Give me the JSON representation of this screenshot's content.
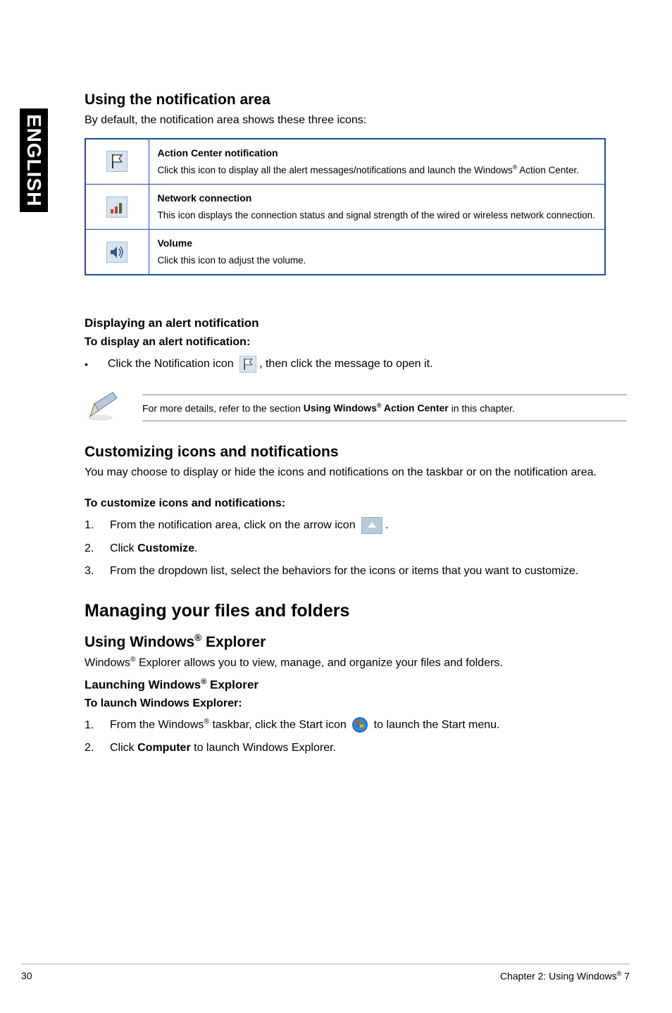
{
  "sidebar": {
    "label": "ENGLISH"
  },
  "section1": {
    "heading": "Using the notification area",
    "intro": "By default, the notification area shows these three icons:",
    "rows": [
      {
        "title": "Action Center notification",
        "desc_pre": "Click this icon to display all the alert messages/notifications and launch the Windows",
        "desc_post": " Action Center."
      },
      {
        "title": "Network connection",
        "desc": "This icon displays the connection status and signal strength of the wired or wireless network connection."
      },
      {
        "title": "Volume",
        "desc": "Click this icon to adjust the volume."
      }
    ]
  },
  "section2": {
    "sub": "Displaying an alert notification",
    "bold": "To display an alert notification:",
    "bullet_pre": "Click the Notification icon ",
    "bullet_post": ", then click the message to open it.",
    "note_pre": "For more details, refer to the section ",
    "note_bold_pre": "Using Windows",
    "note_bold_post": " Action Center",
    "note_post": " in this chapter."
  },
  "section3": {
    "heading": "Customizing icons and notifications",
    "intro": "You may choose to display or hide the icons and notifications on the taskbar or on the notification area.",
    "bold": "To customize icons and notifications:",
    "step1_pre": "From the notification area, click on the arrow icon ",
    "step1_post": ".",
    "step2_pre": "Click ",
    "step2_bold": "Customize",
    "step2_post": ".",
    "step3": "From the dropdown list, select the behaviors for the icons or items that you want to customize."
  },
  "section4": {
    "h1": "Managing your files and folders",
    "heading_pre": "Using Windows",
    "heading_post": " Explorer",
    "intro_pre": "Windows",
    "intro_post": " Explorer allows you to view, manage, and organize your files and folders.",
    "sub_pre": "Launching Windows",
    "sub_post": " Explorer",
    "bold": "To launch Windows Explorer:",
    "step1_pre": "From the Windows",
    "step1_mid": " taskbar, click the Start icon ",
    "step1_post": " to launch the Start menu.",
    "step2_pre": "Click ",
    "step2_bold": "Computer",
    "step2_post": " to launch Windows Explorer."
  },
  "footer": {
    "page": "30",
    "chapter_pre": "Chapter 2: Using Windows",
    "chapter_post": " 7"
  },
  "sup": "®"
}
